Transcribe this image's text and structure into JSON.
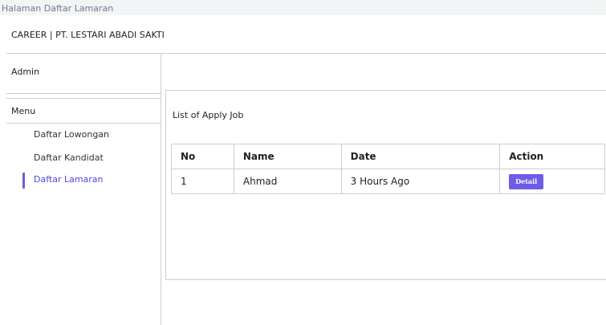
{
  "window": {
    "title": "Halaman Daftar Lamaran"
  },
  "header": {
    "brand": "CAREER | PT. LESTARI ABADI SAKTI"
  },
  "sidebar": {
    "user": "Admin",
    "menu_label": "Menu",
    "items": [
      {
        "label": "Daftar Lowongan",
        "active": false
      },
      {
        "label": "Daftar Kandidat",
        "active": false
      },
      {
        "label": "Daftar Lamaran",
        "active": true
      }
    ]
  },
  "main": {
    "title": "List of Apply Job",
    "table": {
      "headers": [
        "No",
        "Name",
        "Date",
        "Action"
      ],
      "rows": [
        {
          "no": "1",
          "name": "Ahmad",
          "date": "3 Hours Ago",
          "action": "Detail"
        }
      ]
    }
  },
  "colors": {
    "accent": "#6c5ce7",
    "border": "#c9cfd6"
  }
}
